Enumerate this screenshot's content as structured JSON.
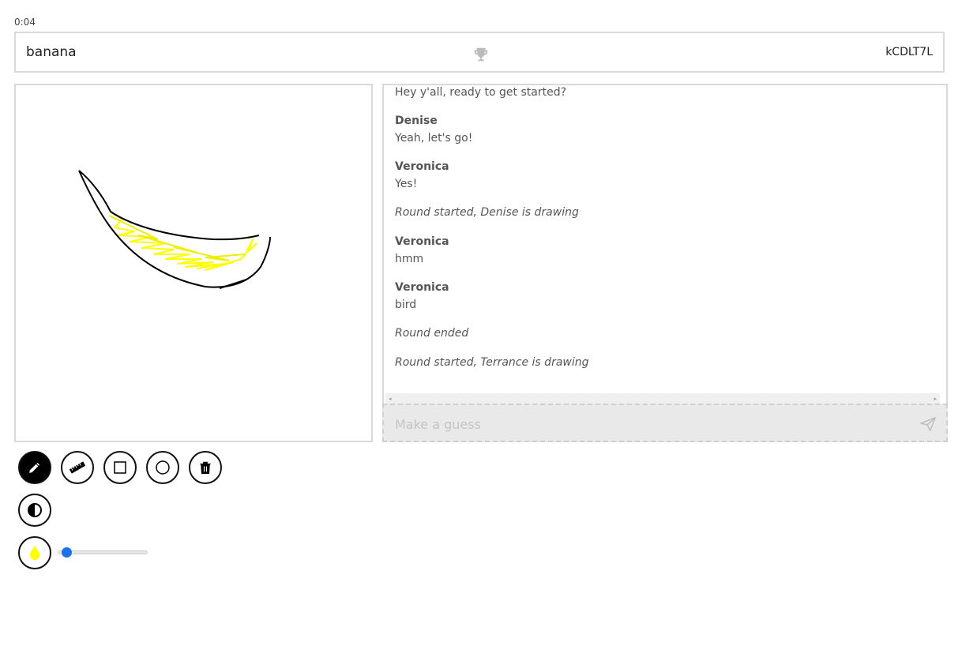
{
  "timer": "0:04",
  "topbar": {
    "word": "banana",
    "room_code": "kCDLT7L",
    "trophy_icon": "trophy-icon"
  },
  "chat": {
    "messages": [
      {
        "type": "text",
        "text": "Hey y'all, ready to get started?"
      },
      {
        "type": "user",
        "author": "Denise",
        "text": "Yeah, let's go!"
      },
      {
        "type": "user",
        "author": "Veronica",
        "text": "Yes!"
      },
      {
        "type": "system",
        "text": "Round started, Denise is drawing"
      },
      {
        "type": "user",
        "author": "Veronica",
        "text": "hmm"
      },
      {
        "type": "user",
        "author": "Veronica",
        "text": "bird"
      },
      {
        "type": "system",
        "text": "Round ended"
      },
      {
        "type": "system",
        "text": "Round started, Terrance is drawing"
      }
    ]
  },
  "guess": {
    "placeholder": "Make a guess",
    "send_icon": "send-icon"
  },
  "toolbar": {
    "tools": [
      "pencil-icon",
      "ruler-icon",
      "square-icon",
      "circle-icon",
      "trash-icon"
    ],
    "active_tool": "pencil",
    "contrast_icon": "contrast-icon",
    "color_icon": "droplet-icon",
    "current_color": "#ffff00",
    "brush_size_fraction": 0.05
  },
  "colors": {
    "border": "#d9d9d9",
    "slider": "#1a73e8",
    "stroke_black": "#000000",
    "stroke_yellow": "#ffff00"
  }
}
